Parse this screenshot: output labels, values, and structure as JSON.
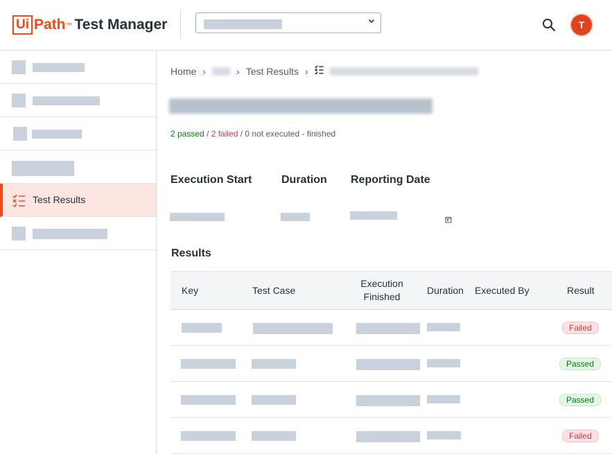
{
  "header": {
    "logo_ui": "Ui",
    "logo_path": "Path",
    "logo_tm": "™",
    "logo_product": "Test Manager",
    "project_select_chevron": "⌄",
    "avatar_initial": "T"
  },
  "sidebar": {
    "active_label": "Test Results"
  },
  "breadcrumb": {
    "home": "Home",
    "sep": "›",
    "test_results": "Test Results"
  },
  "summary": {
    "passed": "2 passed",
    "slash1": " / ",
    "failed": "2 failed",
    "rest": " / 0 not executed - finished"
  },
  "meta": {
    "execution_start_label": "Execution Start",
    "duration_label": "Duration",
    "reporting_date_label": "Reporting Date"
  },
  "results": {
    "title": "Results",
    "columns": {
      "key": "Key",
      "test_case": "Test Case",
      "execution_finished_1": "Execution",
      "execution_finished_2": "Finished",
      "duration": "Duration",
      "executed_by": "Executed By",
      "result": "Result"
    },
    "rows": [
      {
        "result": "Failed",
        "status": "failed"
      },
      {
        "result": "Passed",
        "status": "passed"
      },
      {
        "result": "Passed",
        "status": "passed"
      },
      {
        "result": "Failed",
        "status": "failed"
      }
    ]
  },
  "colors": {
    "brand": "#fa4616",
    "passed": "#038108",
    "failed": "#cc3d45",
    "active_nav_bg": "#fde6e1"
  }
}
